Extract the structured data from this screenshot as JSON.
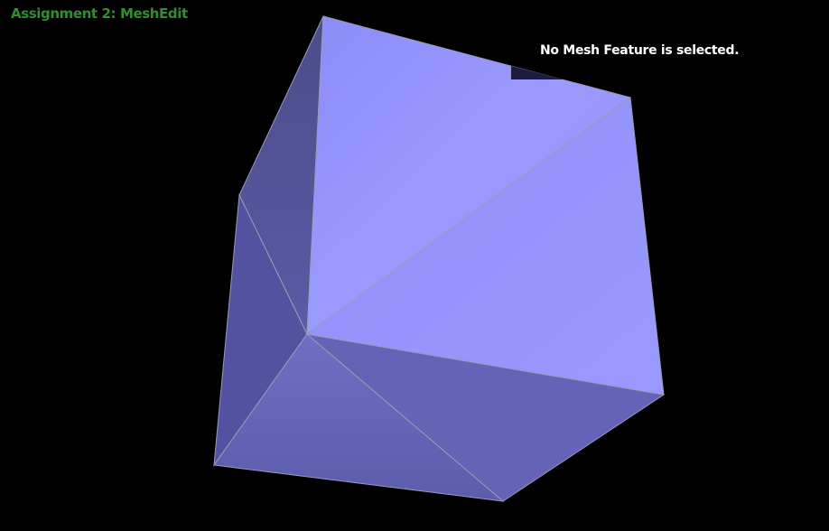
{
  "app": {
    "title": "Assignment 2: MeshEdit"
  },
  "status": {
    "text": "No Mesh Feature is selected."
  },
  "colors": {
    "background": "#000000",
    "title": "#2f8f2f",
    "status_text": "#ffffff",
    "mesh_edge": "#a0a0a0"
  },
  "mesh": {
    "shape": "cube",
    "selected_feature": "none"
  }
}
